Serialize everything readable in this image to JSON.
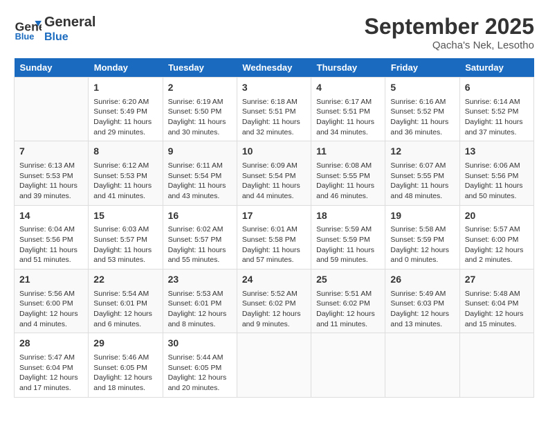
{
  "header": {
    "logo_line1": "General",
    "logo_line2": "Blue",
    "month": "September 2025",
    "location": "Qacha's Nek, Lesotho"
  },
  "days_of_week": [
    "Sunday",
    "Monday",
    "Tuesday",
    "Wednesday",
    "Thursday",
    "Friday",
    "Saturday"
  ],
  "weeks": [
    [
      {
        "day": "",
        "info": ""
      },
      {
        "day": "1",
        "info": "Sunrise: 6:20 AM\nSunset: 5:49 PM\nDaylight: 11 hours\nand 29 minutes."
      },
      {
        "day": "2",
        "info": "Sunrise: 6:19 AM\nSunset: 5:50 PM\nDaylight: 11 hours\nand 30 minutes."
      },
      {
        "day": "3",
        "info": "Sunrise: 6:18 AM\nSunset: 5:51 PM\nDaylight: 11 hours\nand 32 minutes."
      },
      {
        "day": "4",
        "info": "Sunrise: 6:17 AM\nSunset: 5:51 PM\nDaylight: 11 hours\nand 34 minutes."
      },
      {
        "day": "5",
        "info": "Sunrise: 6:16 AM\nSunset: 5:52 PM\nDaylight: 11 hours\nand 36 minutes."
      },
      {
        "day": "6",
        "info": "Sunrise: 6:14 AM\nSunset: 5:52 PM\nDaylight: 11 hours\nand 37 minutes."
      }
    ],
    [
      {
        "day": "7",
        "info": "Sunrise: 6:13 AM\nSunset: 5:53 PM\nDaylight: 11 hours\nand 39 minutes."
      },
      {
        "day": "8",
        "info": "Sunrise: 6:12 AM\nSunset: 5:53 PM\nDaylight: 11 hours\nand 41 minutes."
      },
      {
        "day": "9",
        "info": "Sunrise: 6:11 AM\nSunset: 5:54 PM\nDaylight: 11 hours\nand 43 minutes."
      },
      {
        "day": "10",
        "info": "Sunrise: 6:09 AM\nSunset: 5:54 PM\nDaylight: 11 hours\nand 44 minutes."
      },
      {
        "day": "11",
        "info": "Sunrise: 6:08 AM\nSunset: 5:55 PM\nDaylight: 11 hours\nand 46 minutes."
      },
      {
        "day": "12",
        "info": "Sunrise: 6:07 AM\nSunset: 5:55 PM\nDaylight: 11 hours\nand 48 minutes."
      },
      {
        "day": "13",
        "info": "Sunrise: 6:06 AM\nSunset: 5:56 PM\nDaylight: 11 hours\nand 50 minutes."
      }
    ],
    [
      {
        "day": "14",
        "info": "Sunrise: 6:04 AM\nSunset: 5:56 PM\nDaylight: 11 hours\nand 51 minutes."
      },
      {
        "day": "15",
        "info": "Sunrise: 6:03 AM\nSunset: 5:57 PM\nDaylight: 11 hours\nand 53 minutes."
      },
      {
        "day": "16",
        "info": "Sunrise: 6:02 AM\nSunset: 5:57 PM\nDaylight: 11 hours\nand 55 minutes."
      },
      {
        "day": "17",
        "info": "Sunrise: 6:01 AM\nSunset: 5:58 PM\nDaylight: 11 hours\nand 57 minutes."
      },
      {
        "day": "18",
        "info": "Sunrise: 5:59 AM\nSunset: 5:59 PM\nDaylight: 11 hours\nand 59 minutes."
      },
      {
        "day": "19",
        "info": "Sunrise: 5:58 AM\nSunset: 5:59 PM\nDaylight: 12 hours\nand 0 minutes."
      },
      {
        "day": "20",
        "info": "Sunrise: 5:57 AM\nSunset: 6:00 PM\nDaylight: 12 hours\nand 2 minutes."
      }
    ],
    [
      {
        "day": "21",
        "info": "Sunrise: 5:56 AM\nSunset: 6:00 PM\nDaylight: 12 hours\nand 4 minutes."
      },
      {
        "day": "22",
        "info": "Sunrise: 5:54 AM\nSunset: 6:01 PM\nDaylight: 12 hours\nand 6 minutes."
      },
      {
        "day": "23",
        "info": "Sunrise: 5:53 AM\nSunset: 6:01 PM\nDaylight: 12 hours\nand 8 minutes."
      },
      {
        "day": "24",
        "info": "Sunrise: 5:52 AM\nSunset: 6:02 PM\nDaylight: 12 hours\nand 9 minutes."
      },
      {
        "day": "25",
        "info": "Sunrise: 5:51 AM\nSunset: 6:02 PM\nDaylight: 12 hours\nand 11 minutes."
      },
      {
        "day": "26",
        "info": "Sunrise: 5:49 AM\nSunset: 6:03 PM\nDaylight: 12 hours\nand 13 minutes."
      },
      {
        "day": "27",
        "info": "Sunrise: 5:48 AM\nSunset: 6:04 PM\nDaylight: 12 hours\nand 15 minutes."
      }
    ],
    [
      {
        "day": "28",
        "info": "Sunrise: 5:47 AM\nSunset: 6:04 PM\nDaylight: 12 hours\nand 17 minutes."
      },
      {
        "day": "29",
        "info": "Sunrise: 5:46 AM\nSunset: 6:05 PM\nDaylight: 12 hours\nand 18 minutes."
      },
      {
        "day": "30",
        "info": "Sunrise: 5:44 AM\nSunset: 6:05 PM\nDaylight: 12 hours\nand 20 minutes."
      },
      {
        "day": "",
        "info": ""
      },
      {
        "day": "",
        "info": ""
      },
      {
        "day": "",
        "info": ""
      },
      {
        "day": "",
        "info": ""
      }
    ]
  ]
}
